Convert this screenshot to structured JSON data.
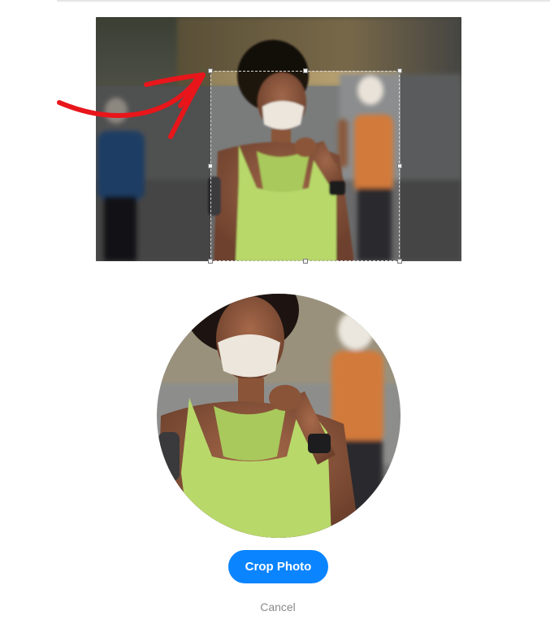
{
  "dialog": {
    "crop_button_label": "Crop Photo",
    "cancel_label": "Cancel"
  },
  "colors": {
    "primary_button": "#0a84ff",
    "cancel_text": "#8a8a8a",
    "annotation": "#e8161b",
    "tank_top": "#b8d86a",
    "background": "#ffffff"
  },
  "icons": {
    "annotation": "red-curved-arrow-icon"
  }
}
